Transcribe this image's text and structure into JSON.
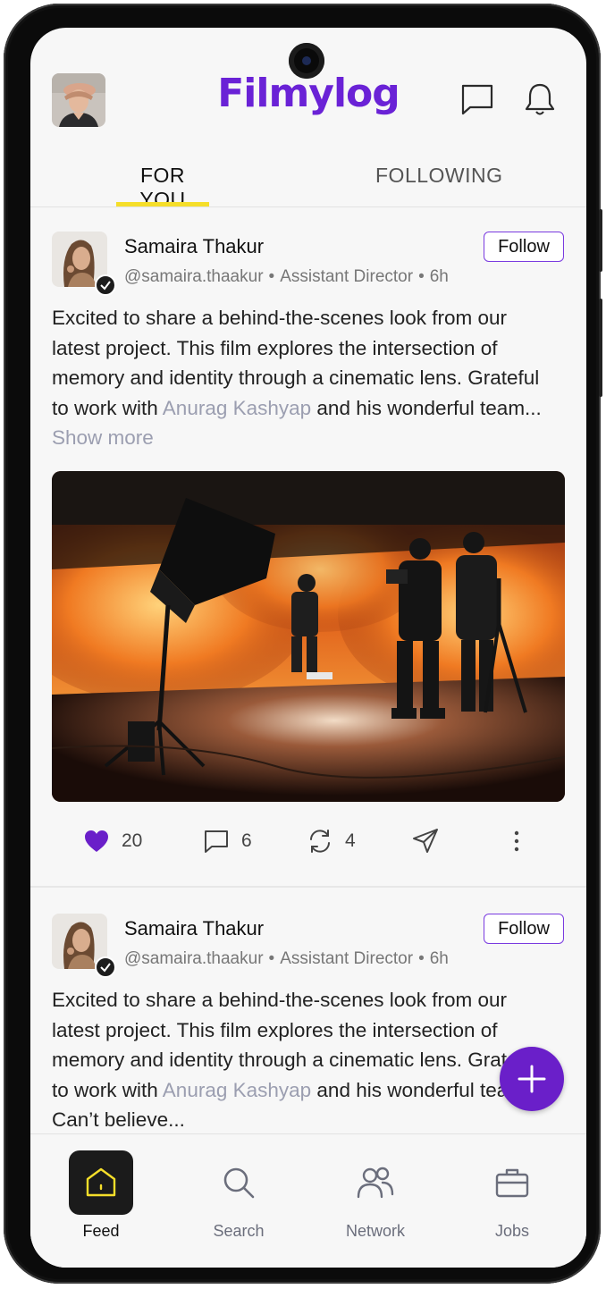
{
  "header": {
    "logo": "Filmylog",
    "chat_icon": "chat-bubble-icon",
    "notification_icon": "bell-icon"
  },
  "tabs": [
    {
      "label": "FOR YOU",
      "active": true
    },
    {
      "label": "FOLLOWING",
      "active": false
    }
  ],
  "posts": [
    {
      "author": "Samaira Thakur",
      "handle": "@samaira.thaakur",
      "role": "Assistant Director",
      "time": "6h",
      "follow_label": "Follow",
      "text_before": "Excited to share a behind-the-scenes look from our latest project. This film explores the intersection of memory and identity through a cinematic lens. Grateful to work with ",
      "mention": "Anurag Kashyap",
      "text_after": " and his wonderful team... ",
      "show_more": "Show more",
      "likes": "20",
      "comments": "6",
      "reposts": "4"
    },
    {
      "author": "Samaira Thakur",
      "handle": "@samaira.thaakur",
      "role": "Assistant Director",
      "time": "6h",
      "follow_label": "Follow",
      "text_before": "Excited to share a behind-the-scenes look from our latest project. This film explores the intersection of memory and identity through a cinematic lens. Grateful to work with ",
      "mention": "Anurag Kashyap",
      "text_after": " and his wonderful team! Can’t believe..."
    }
  ],
  "bottom_nav": [
    {
      "label": "Feed",
      "icon": "home-icon",
      "active": true
    },
    {
      "label": "Search",
      "icon": "search-icon",
      "active": false
    },
    {
      "label": "Network",
      "icon": "people-icon",
      "active": false
    },
    {
      "label": "Jobs",
      "icon": "briefcase-icon",
      "active": false
    }
  ],
  "colors": {
    "brand_purple": "#6a22d6",
    "tab_underline": "#f5de2a",
    "like_purple": "#6a1fc9"
  }
}
